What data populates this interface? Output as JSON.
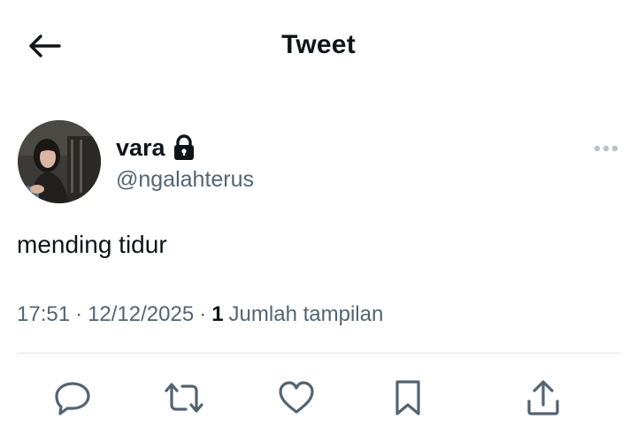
{
  "header": {
    "title": "Tweet",
    "back_icon": "arrow-left-icon"
  },
  "author": {
    "display_name": "vara",
    "handle": "@ngalahterus",
    "protected_icon": "lock-icon"
  },
  "tweet": {
    "text": "mending tidur",
    "time": "17:51",
    "separator": "·",
    "date": "12/12/2025",
    "views_count": "1",
    "views_label": "Jumlah tampilan"
  },
  "actions": [
    {
      "name": "reply-icon"
    },
    {
      "name": "retweet-icon"
    },
    {
      "name": "like-icon"
    },
    {
      "name": "bookmark-icon"
    },
    {
      "name": "share-icon"
    }
  ],
  "colors": {
    "text": "#0f1419",
    "secondary": "#536471",
    "divider": "#e1e6ea"
  }
}
